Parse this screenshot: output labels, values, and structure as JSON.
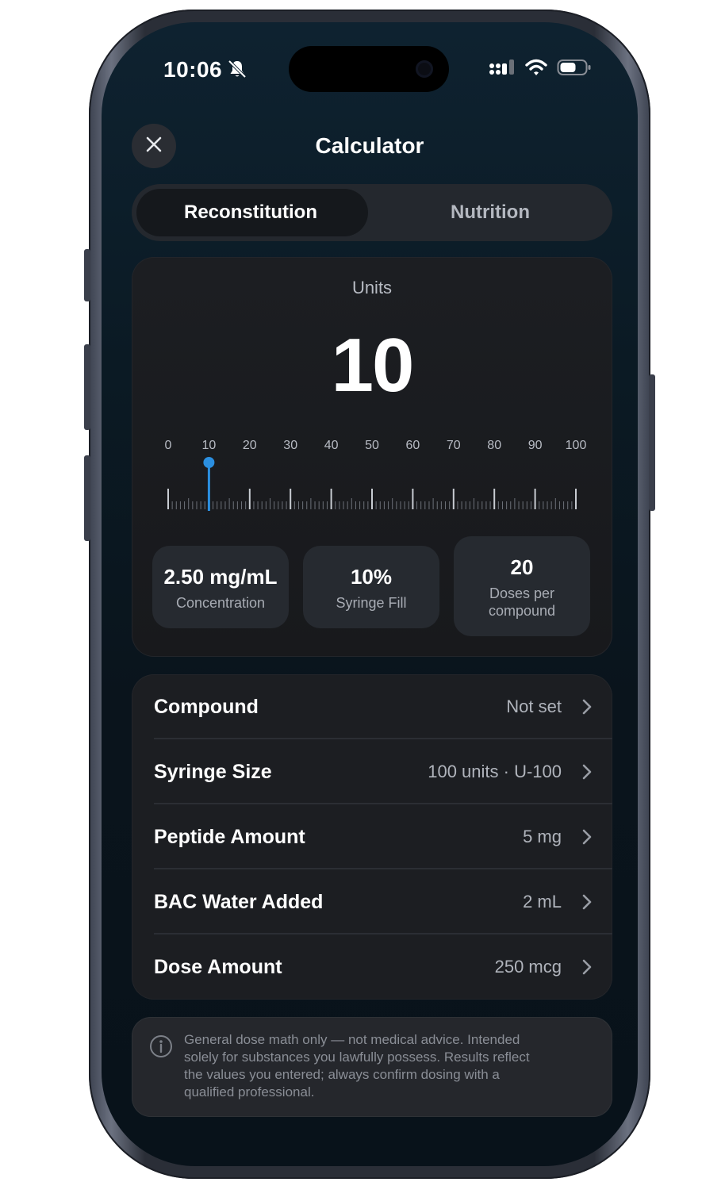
{
  "status_bar": {
    "time": "10:06"
  },
  "header": {
    "title": "Calculator"
  },
  "tabs": [
    {
      "label": "Reconstitution",
      "active": true
    },
    {
      "label": "Nutrition",
      "active": false
    }
  ],
  "result": {
    "label": "Units",
    "value": "10",
    "scale_ticks": [
      "0",
      "10",
      "20",
      "30",
      "40",
      "50",
      "60",
      "70",
      "80",
      "90",
      "100"
    ],
    "marker_value": 10,
    "accent_color": "#2b8fe0"
  },
  "stats": [
    {
      "value": "2.50 mg/mL",
      "label": "Concentration"
    },
    {
      "value": "10%",
      "label": "Syringe Fill"
    },
    {
      "value": "20",
      "label_line1": "Doses per",
      "label_line2": "compound"
    }
  ],
  "settings": [
    {
      "label": "Compound",
      "value": "Not set"
    },
    {
      "label": "Syringe Size",
      "value": "100 units · U-100"
    },
    {
      "label": "Peptide Amount",
      "value": "5 mg"
    },
    {
      "label": "BAC Water Added",
      "value": "2 mL"
    },
    {
      "label": "Dose Amount",
      "value": "250 mcg"
    }
  ],
  "disclaimer": {
    "line1": "General dose math only — not medical advice. Intended",
    "line2": "solely for substances you lawfully possess. Results reflect",
    "line3": "the values you entered; always confirm dosing with a",
    "line4": "qualified professional."
  }
}
